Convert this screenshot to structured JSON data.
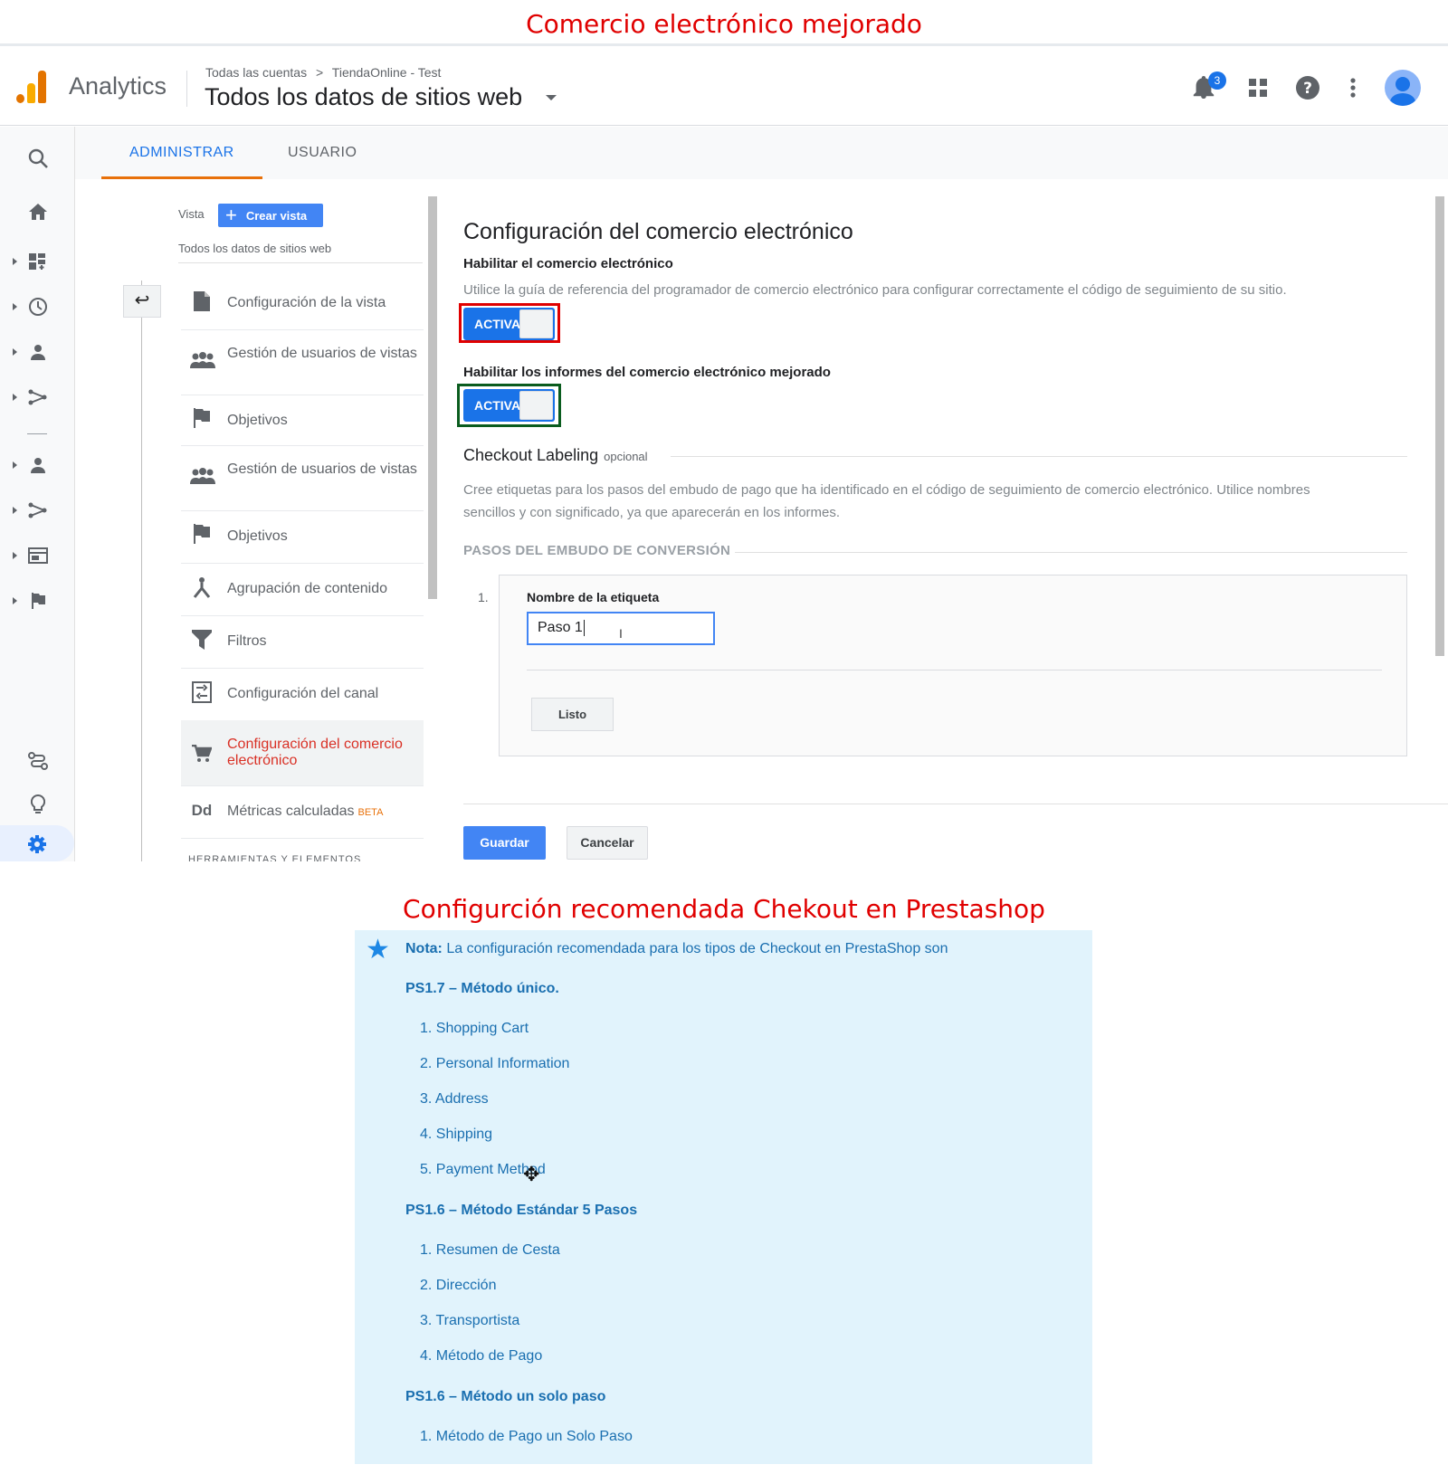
{
  "captions": {
    "top": "Comercio electrónico mejorado",
    "bottom": "Configurción recomendada Chekout en Prestashop"
  },
  "header": {
    "app_name": "Analytics",
    "breadcrumb_account": "Todas las cuentas",
    "breadcrumb_sep": ">",
    "breadcrumb_property": "TiendaOnline - Test",
    "property_title": "Todos los datos de sitios web",
    "notification_count": "3",
    "icons": [
      "bell-icon",
      "apps-grid-icon",
      "help-icon",
      "more-vert-icon",
      "account-avatar-icon"
    ]
  },
  "tabs": [
    {
      "label": "ADMINISTRAR",
      "active": true
    },
    {
      "label": "USUARIO",
      "active": false
    }
  ],
  "view_panel": {
    "vista_label": "Vista",
    "create_button": "Crear vista",
    "view_name": "Todos los datos de sitios web",
    "items": [
      {
        "label": "Configuración de la vista",
        "icon": "document-icon"
      },
      {
        "label": "Gestión de usuarios de vistas",
        "icon": "people-icon"
      },
      {
        "label": "Objetivos",
        "icon": "flag-icon"
      },
      {
        "label": "Gestión de usuarios de vistas",
        "icon": "people-icon"
      },
      {
        "label": "Objetivos",
        "icon": "flag-icon"
      },
      {
        "label": "Agrupación de contenido",
        "icon": "hierarchy-icon"
      },
      {
        "label": "Filtros",
        "icon": "filter-icon"
      },
      {
        "label": "Configuración del canal",
        "icon": "channel-icon"
      },
      {
        "label": "Configuración del comercio electrónico",
        "icon": "cart-icon",
        "active": true
      },
      {
        "label": "Métricas calculadas",
        "icon": "dd-icon",
        "badge": "BETA"
      }
    ],
    "section_cut": "HERRAMIENTAS Y ELEMENTOS"
  },
  "settings": {
    "title": "Configuración del comercio electrónico",
    "enable_ecommerce": "Habilitar el comercio electrónico",
    "enable_desc": "Utilice la guía de referencia del programador de comercio electrónico para configurar correctamente el código de seguimiento de su sitio.",
    "toggle1": "ACTIVA",
    "enable_enhanced": "Habilitar los informes del comercio electrónico mejorado",
    "toggle2": "ACTIVA",
    "checkout_title": "Checkout Labeling",
    "checkout_optional": "opcional",
    "checkout_desc_1": "Cree etiquetas para los pasos del embudo de pago que ha identificado en el código de seguimiento de comercio electrónico. Utilice nombres",
    "checkout_desc_2": "sencillos y con significado, ya que aparecerán en los informes.",
    "funnel_heading": "PASOS DEL EMBUDO DE CONVERSIÓN",
    "step_number": "1.",
    "step_label": "Nombre de la etiqueta",
    "step_value": "Paso 1",
    "done_button": "Listo",
    "save_button": "Guardar",
    "cancel_button": "Cancelar"
  },
  "note": {
    "prefix": "Nota:",
    "text": " La configuración recomendada para los tipos de Checkout en PrestaShop son",
    "groups": [
      {
        "title": "PS1.7 – Método único.",
        "items": [
          "1. Shopping Cart",
          "2. Personal Information",
          "3. Address",
          "4. Shipping",
          "5. Payment Method"
        ]
      },
      {
        "title": "PS1.6 – Método Estándar 5 Pasos",
        "items": [
          "1. Resumen de Cesta",
          "2. Dirección",
          "3. Transportista",
          "4. Método de Pago"
        ]
      },
      {
        "title": "PS1.6 – Método un solo paso",
        "items": [
          "1. Método de Pago un Solo Paso"
        ]
      }
    ]
  },
  "colors": {
    "caption_red": "#e00000",
    "ga_blue": "#1a73e8",
    "tab_orange": "#e8710a",
    "red_frame": "#e00000",
    "green_frame": "#0a5c1e",
    "note_bg": "#e1f3fc",
    "note_text": "#1a6fb0"
  }
}
